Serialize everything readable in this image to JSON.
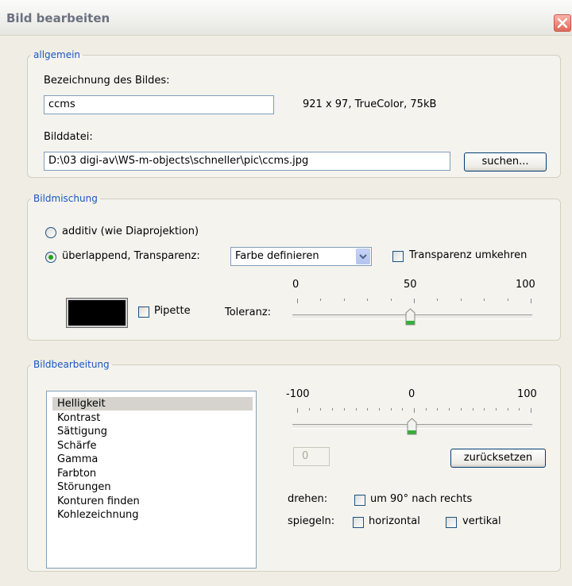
{
  "dialog": {
    "title": "Bild bearbeiten",
    "close_icon": "close-icon"
  },
  "allgemein": {
    "legend": "allgemein",
    "name_label": "Bezeichnung des Bildes:",
    "name_value": "ccms",
    "info": "921 x 97, TrueColor, 75kB",
    "file_label": "Bilddatei:",
    "file_value": "D:\\03 digi-av\\WS-m-objects\\schneller\\pic\\ccms.jpg",
    "browse_button": "suchen..."
  },
  "bildmischung": {
    "legend": "Bildmischung",
    "radio_additive": "additiv (wie Diaprojektion)",
    "radio_additive_checked": false,
    "radio_overlap": "überlappend, Transparenz:",
    "radio_overlap_checked": true,
    "transparency_mode": "Farbe definieren",
    "invert_label": "Transparenz umkehren",
    "invert_checked": false,
    "color": "#000000",
    "pipette_label": "Pipette",
    "pipette_checked": false,
    "tolerance_label": "Toleranz:",
    "tolerance_min": "0",
    "tolerance_mid": "50",
    "tolerance_max": "100",
    "tolerance_value": 50
  },
  "bildbearbeitung": {
    "legend": "Bildbearbeitung",
    "items": [
      "Helligkeit",
      "Kontrast",
      "Sättigung",
      "Schärfe",
      "Gamma",
      "Farbton",
      "Störungen",
      "Konturen finden",
      "Kohlezeichnung"
    ],
    "selected_index": 0,
    "slider_min": "-100",
    "slider_mid": "0",
    "slider_max": "100",
    "slider_value": 0,
    "value_box": "0",
    "reset_button": "zurücksetzen",
    "rotate_label": "drehen:",
    "rotate_option": "um 90° nach rechts",
    "rotate_checked": false,
    "mirror_label": "spiegeln:",
    "mirror_horizontal": "horizontal",
    "mirror_horizontal_checked": false,
    "mirror_vertical": "vertikal",
    "mirror_vertical_checked": false
  }
}
